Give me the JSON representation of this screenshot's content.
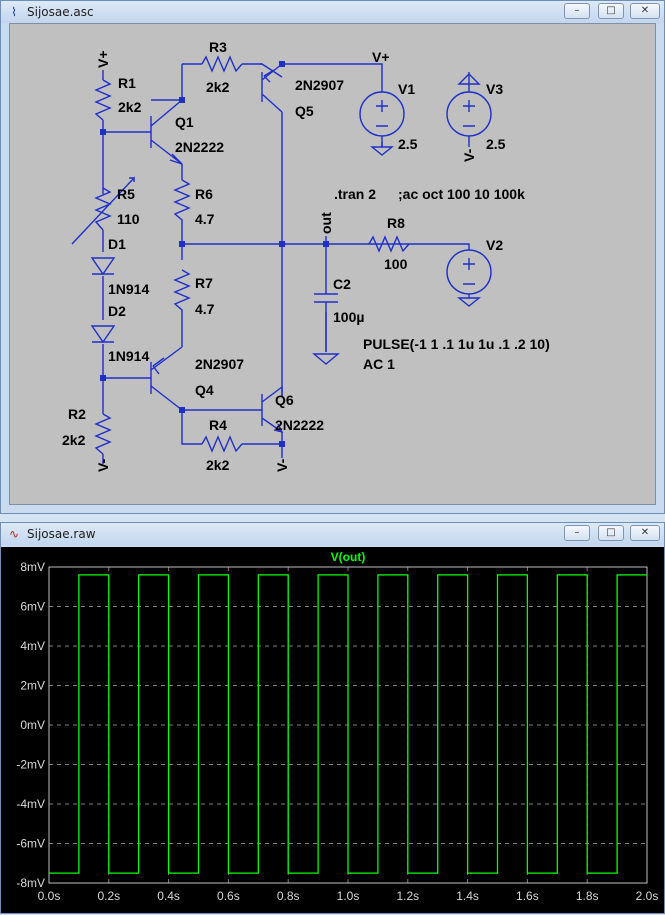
{
  "schematic_window": {
    "title": "Sijosae.asc",
    "controls": {
      "minimize": "–",
      "maximize": "□",
      "close": "✕"
    },
    "labels": {
      "vplus_left": "V+",
      "r1_name": "R1",
      "r1_value": "2k2",
      "r3_name": "R3",
      "r3_value": "2k2",
      "q5_model": "2N2907",
      "q5_name": "Q5",
      "v1_name": "V1",
      "v1_net": "V+",
      "v1_value": "2.5",
      "v3_name": "V3",
      "v3_net": "V-",
      "v3_value": "2.5",
      "q1_name": "Q1",
      "q1_model": "2N2222",
      "r5_name": "R5",
      "r5_value": "110",
      "r6_name": "R6",
      "r6_value": "4.7",
      "d1_name": "D1",
      "d1_model": "1N914",
      "r7_name": "R7",
      "r7_value": "4.7",
      "d2_name": "D2",
      "d2_model": "1N914",
      "q4_model": "2N2907",
      "q4_name": "Q4",
      "q6_name": "Q6",
      "q6_model": "2N2222",
      "r2_name": "R2",
      "r2_value": "2k2",
      "r2_net": "V-",
      "r4_name": "R4",
      "r4_value": "2k2",
      "q6_net": "V-",
      "tran_directive": ".tran 2",
      "ac_directive": ";ac oct 100 10 100k",
      "out_net": "out",
      "r8_name": "R8",
      "r8_value": "100",
      "v2_name": "V2",
      "c2_name": "C2",
      "c2_value": "100µ",
      "pulse_spec": "PULSE(-1 1 .1 1u 1u .1 .2 10)",
      "ac_spec": "AC 1"
    }
  },
  "waveform_window": {
    "title": "Sijosae.raw",
    "controls": {
      "minimize": "–",
      "maximize": "□",
      "close": "✕"
    },
    "trace_label": "V(out)",
    "colors": {
      "trace": "#00ff00",
      "background": "#000000",
      "grid": "#808080",
      "axis_text": "#d8d8d8"
    },
    "chart_data": {
      "type": "line",
      "xlim": [
        0,
        2.0
      ],
      "ylim": [
        -8,
        8
      ],
      "xticks": [
        "0.0s",
        "0.2s",
        "0.4s",
        "0.6s",
        "0.8s",
        "1.0s",
        "1.2s",
        "1.4s",
        "1.6s",
        "1.8s",
        "2.0s"
      ],
      "yticks": [
        "8mV",
        "6mV",
        "4mV",
        "2mV",
        "0mV",
        "-2mV",
        "-4mV",
        "-6mV",
        "-8mV"
      ],
      "x_unit": "s",
      "y_unit": "mV",
      "series": [
        {
          "name": "V(out)",
          "x": [
            0,
            0.1,
            0.1,
            0.2,
            0.2,
            0.3,
            0.3,
            0.4,
            0.4,
            0.5,
            0.5,
            0.6,
            0.6,
            0.7,
            0.7,
            0.8,
            0.8,
            0.9,
            0.9,
            1.0,
            1.0,
            1.1,
            1.1,
            1.2,
            1.2,
            1.3,
            1.3,
            1.4,
            1.4,
            1.5,
            1.5,
            1.6,
            1.6,
            1.7,
            1.7,
            1.8,
            1.8,
            1.9,
            1.9,
            2.0
          ],
          "y": [
            -7.5,
            -7.5,
            7.6,
            7.6,
            -7.5,
            -7.5,
            7.6,
            7.6,
            -7.5,
            -7.5,
            7.6,
            7.6,
            -7.5,
            -7.5,
            7.6,
            7.6,
            -7.5,
            -7.5,
            7.6,
            7.6,
            -7.5,
            -7.5,
            7.6,
            7.6,
            -7.5,
            -7.5,
            7.6,
            7.6,
            -7.5,
            -7.5,
            7.6,
            7.6,
            -7.5,
            -7.5,
            7.6,
            7.6,
            -7.5,
            -7.5,
            7.6,
            7.6
          ]
        }
      ]
    }
  }
}
